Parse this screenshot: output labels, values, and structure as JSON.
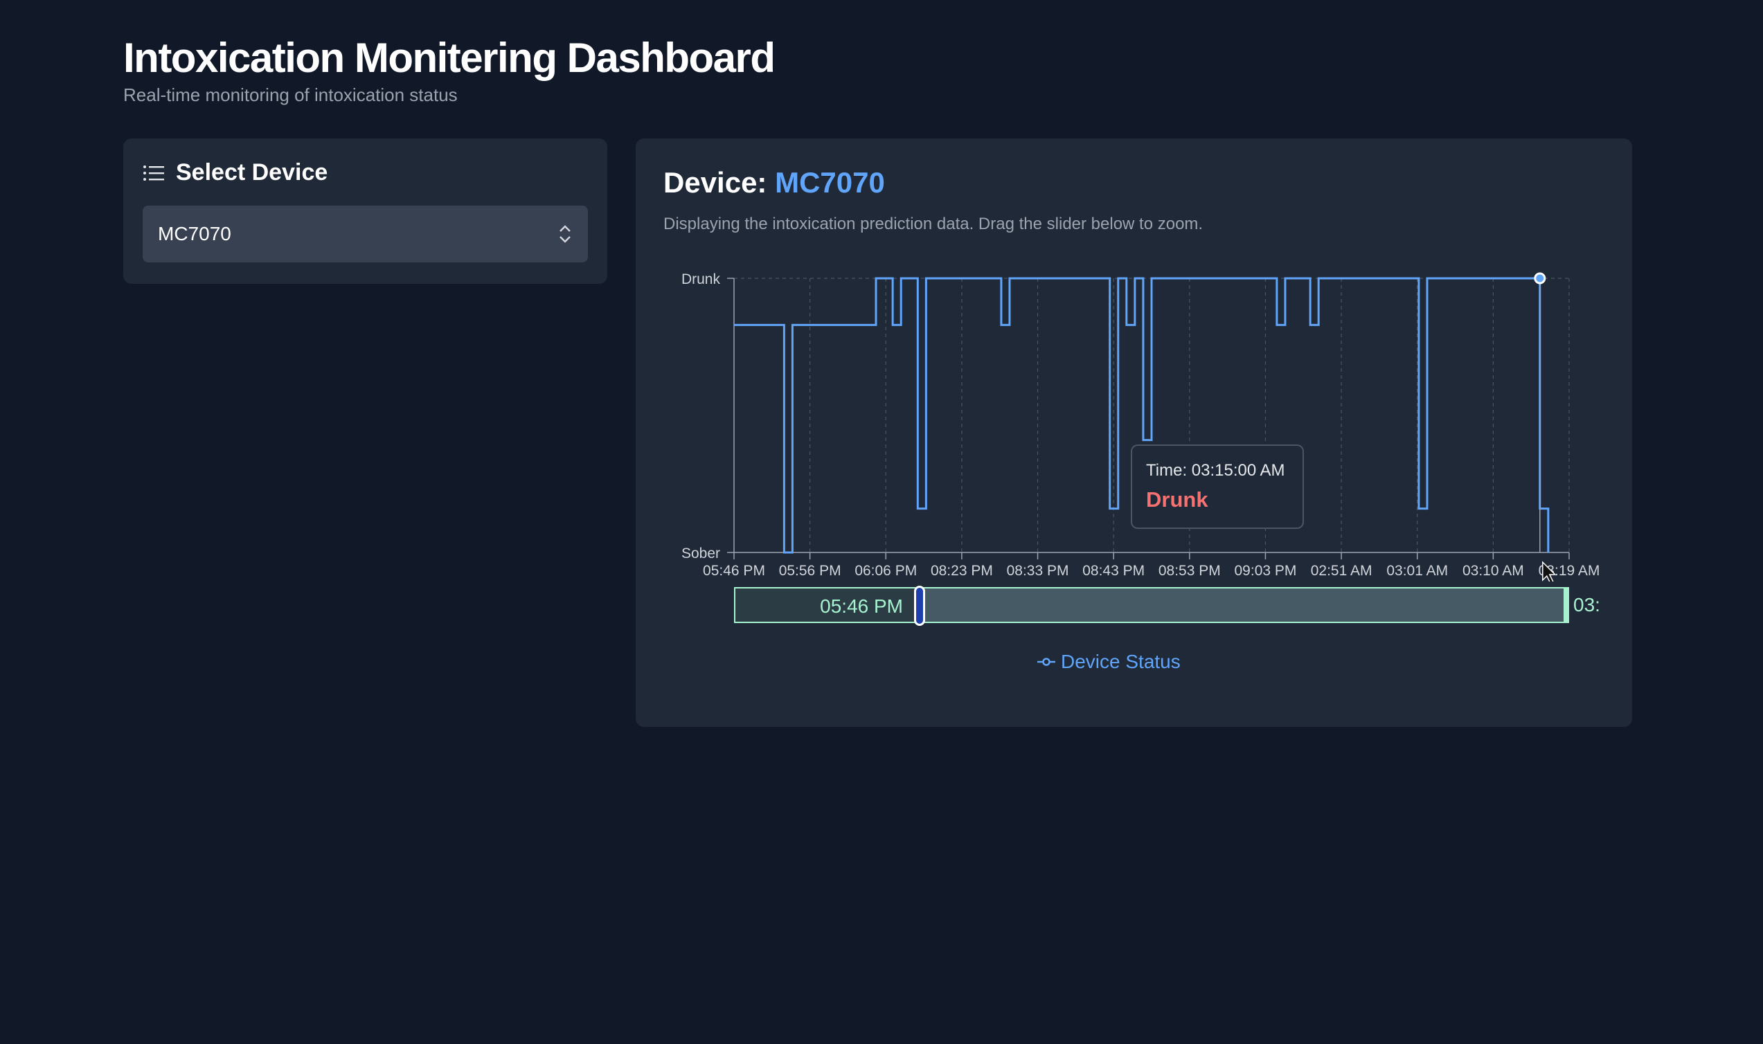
{
  "header": {
    "title": "Intoxication Monitering Dashboard",
    "subtitle": "Real-time monitoring of intoxication status"
  },
  "device_panel": {
    "heading": "Select Device",
    "selected": "MC7070",
    "icon": "list-icon"
  },
  "main": {
    "device_label": "Device:",
    "device_name": "MC7070",
    "description": "Displaying the intoxication prediction data. Drag the slider below to zoom."
  },
  "tooltip": {
    "time": "Time: 03:15:00 AM",
    "value": "Drunk"
  },
  "brush": {
    "start_label": "05:46 PM",
    "end_label": "03:",
    "start_fraction": 0.22,
    "end_fraction": 1.0
  },
  "legend": {
    "label": "Device Status",
    "icon": "line-dot-icon"
  },
  "colors": {
    "accent": "#60a5fa",
    "drunk": "#f87171",
    "brush": "#a7f3d0",
    "bg": "#111827",
    "panel": "#1f2937"
  },
  "chart_data": {
    "type": "line",
    "step": true,
    "y_categories": [
      "Sober",
      "Drunk"
    ],
    "x_ticks": [
      "05:46 PM",
      "05:56 PM",
      "06:06 PM",
      "08:23 PM",
      "08:33 PM",
      "08:43 PM",
      "08:53 PM",
      "09:03 PM",
      "02:51 AM",
      "03:01 AM",
      "03:10 AM",
      "03:19 AM"
    ],
    "series": [
      {
        "values": [
          [
            0.0,
            0.83
          ],
          [
            0.06,
            0.83
          ],
          [
            0.06,
            0
          ],
          [
            0.07,
            0
          ],
          [
            0.07,
            0.83
          ],
          [
            0.17,
            0.83
          ],
          [
            0.17,
            1
          ],
          [
            0.19,
            1
          ],
          [
            0.19,
            0.83
          ],
          [
            0.2,
            0.83
          ],
          [
            0.2,
            1
          ],
          [
            0.22,
            1
          ],
          [
            0.22,
            0.16
          ],
          [
            0.23,
            0.16
          ],
          [
            0.23,
            1
          ],
          [
            0.32,
            1
          ],
          [
            0.32,
            0.83
          ],
          [
            0.33,
            0.83
          ],
          [
            0.33,
            1
          ],
          [
            0.45,
            1
          ],
          [
            0.45,
            0.16
          ],
          [
            0.46,
            0.16
          ],
          [
            0.46,
            1
          ],
          [
            0.47,
            1
          ],
          [
            0.47,
            0.83
          ],
          [
            0.48,
            0.83
          ],
          [
            0.48,
            1
          ],
          [
            0.49,
            1
          ],
          [
            0.49,
            0.41
          ],
          [
            0.5,
            0.41
          ],
          [
            0.5,
            1
          ],
          [
            0.65,
            1
          ],
          [
            0.65,
            0.83
          ],
          [
            0.66,
            0.83
          ],
          [
            0.66,
            1
          ],
          [
            0.69,
            1
          ],
          [
            0.69,
            0.83
          ],
          [
            0.7,
            0.83
          ],
          [
            0.7,
            1
          ],
          [
            0.82,
            1
          ],
          [
            0.82,
            0.16
          ],
          [
            0.83,
            0.16
          ],
          [
            0.83,
            1
          ],
          [
            0.965,
            1
          ],
          [
            0.965,
            0.16
          ],
          [
            0.975,
            0.16
          ],
          [
            0.975,
            0
          ]
        ]
      }
    ],
    "highlight": {
      "time": "03:15:00 AM",
      "value": "Drunk"
    },
    "grid": true,
    "legend_position": "bottom-center"
  }
}
